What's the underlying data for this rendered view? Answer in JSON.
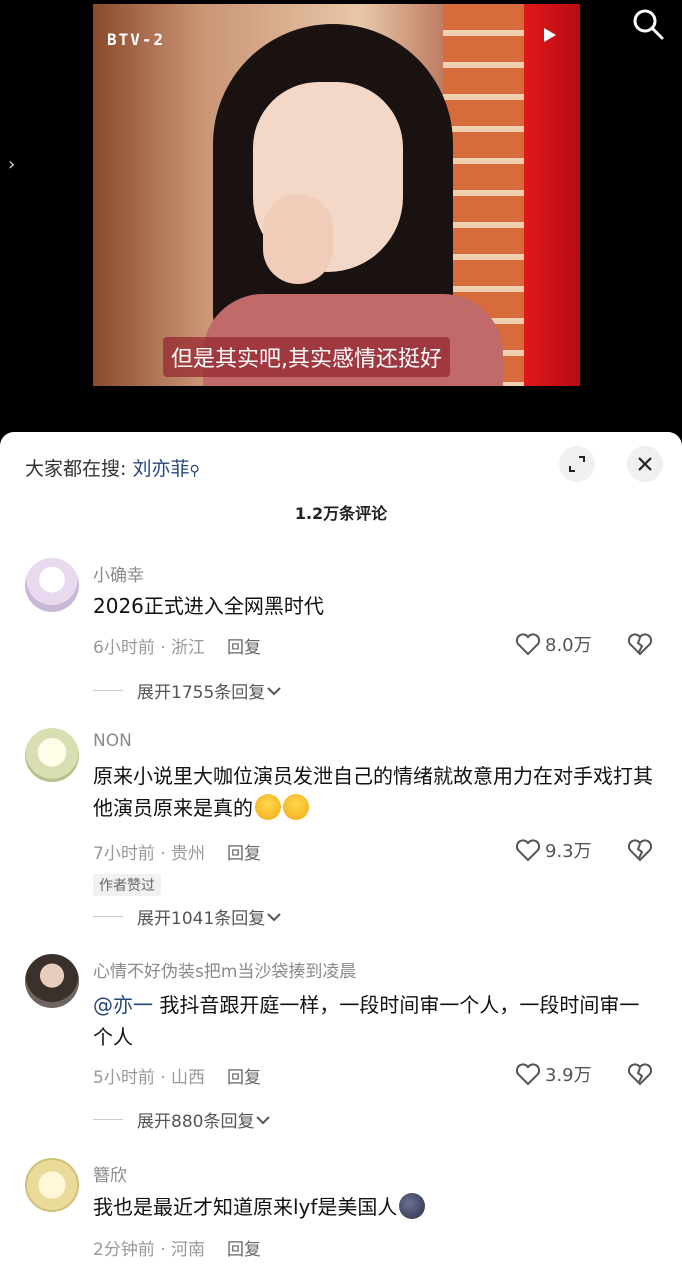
{
  "video": {
    "channel_logo": "BTV-2",
    "subtitle": "但是其实吧,其实感情还挺好"
  },
  "hot_search": {
    "prefix": "大家都在搜:",
    "keyword": "刘亦菲"
  },
  "comment_count": "1.2万条评论",
  "comments": [
    {
      "user": "小确幸",
      "text": "2026正式进入全网黑时代",
      "time": "6小时前 · 浙江",
      "reply": "回复",
      "likes": "8.0万",
      "expand": "展开1755条回复"
    },
    {
      "user": "NON",
      "text": "原来小说里大咖位演员发泄自己的情绪就故意用力在对手戏打其他演员原来是真的",
      "time": "7小时前 · 贵州",
      "reply": "回复",
      "likes": "9.3万",
      "badge": "作者赞过",
      "expand": "展开1041条回复"
    },
    {
      "user": "心情不好伪装s把m当沙袋揍到凌晨",
      "mention": "@亦一",
      "text": "我抖音跟开庭一样，一段时间审一个人，一段时间审一个人",
      "time": "5小时前 · 山西",
      "reply": "回复",
      "likes": "3.9万",
      "expand": "展开880条回复"
    },
    {
      "user": "簪欣",
      "text": "我也是最近才知道原来lyf是美国人",
      "time": "2分钟前 · 河南",
      "reply": "回复"
    }
  ],
  "icons": {
    "search": "search-icon",
    "expand": "expand-icon",
    "close": "close-icon",
    "like": "heart-icon",
    "dislike": "broken-heart-icon"
  },
  "colors": {
    "mention": "#26477a",
    "meta": "#999999"
  }
}
